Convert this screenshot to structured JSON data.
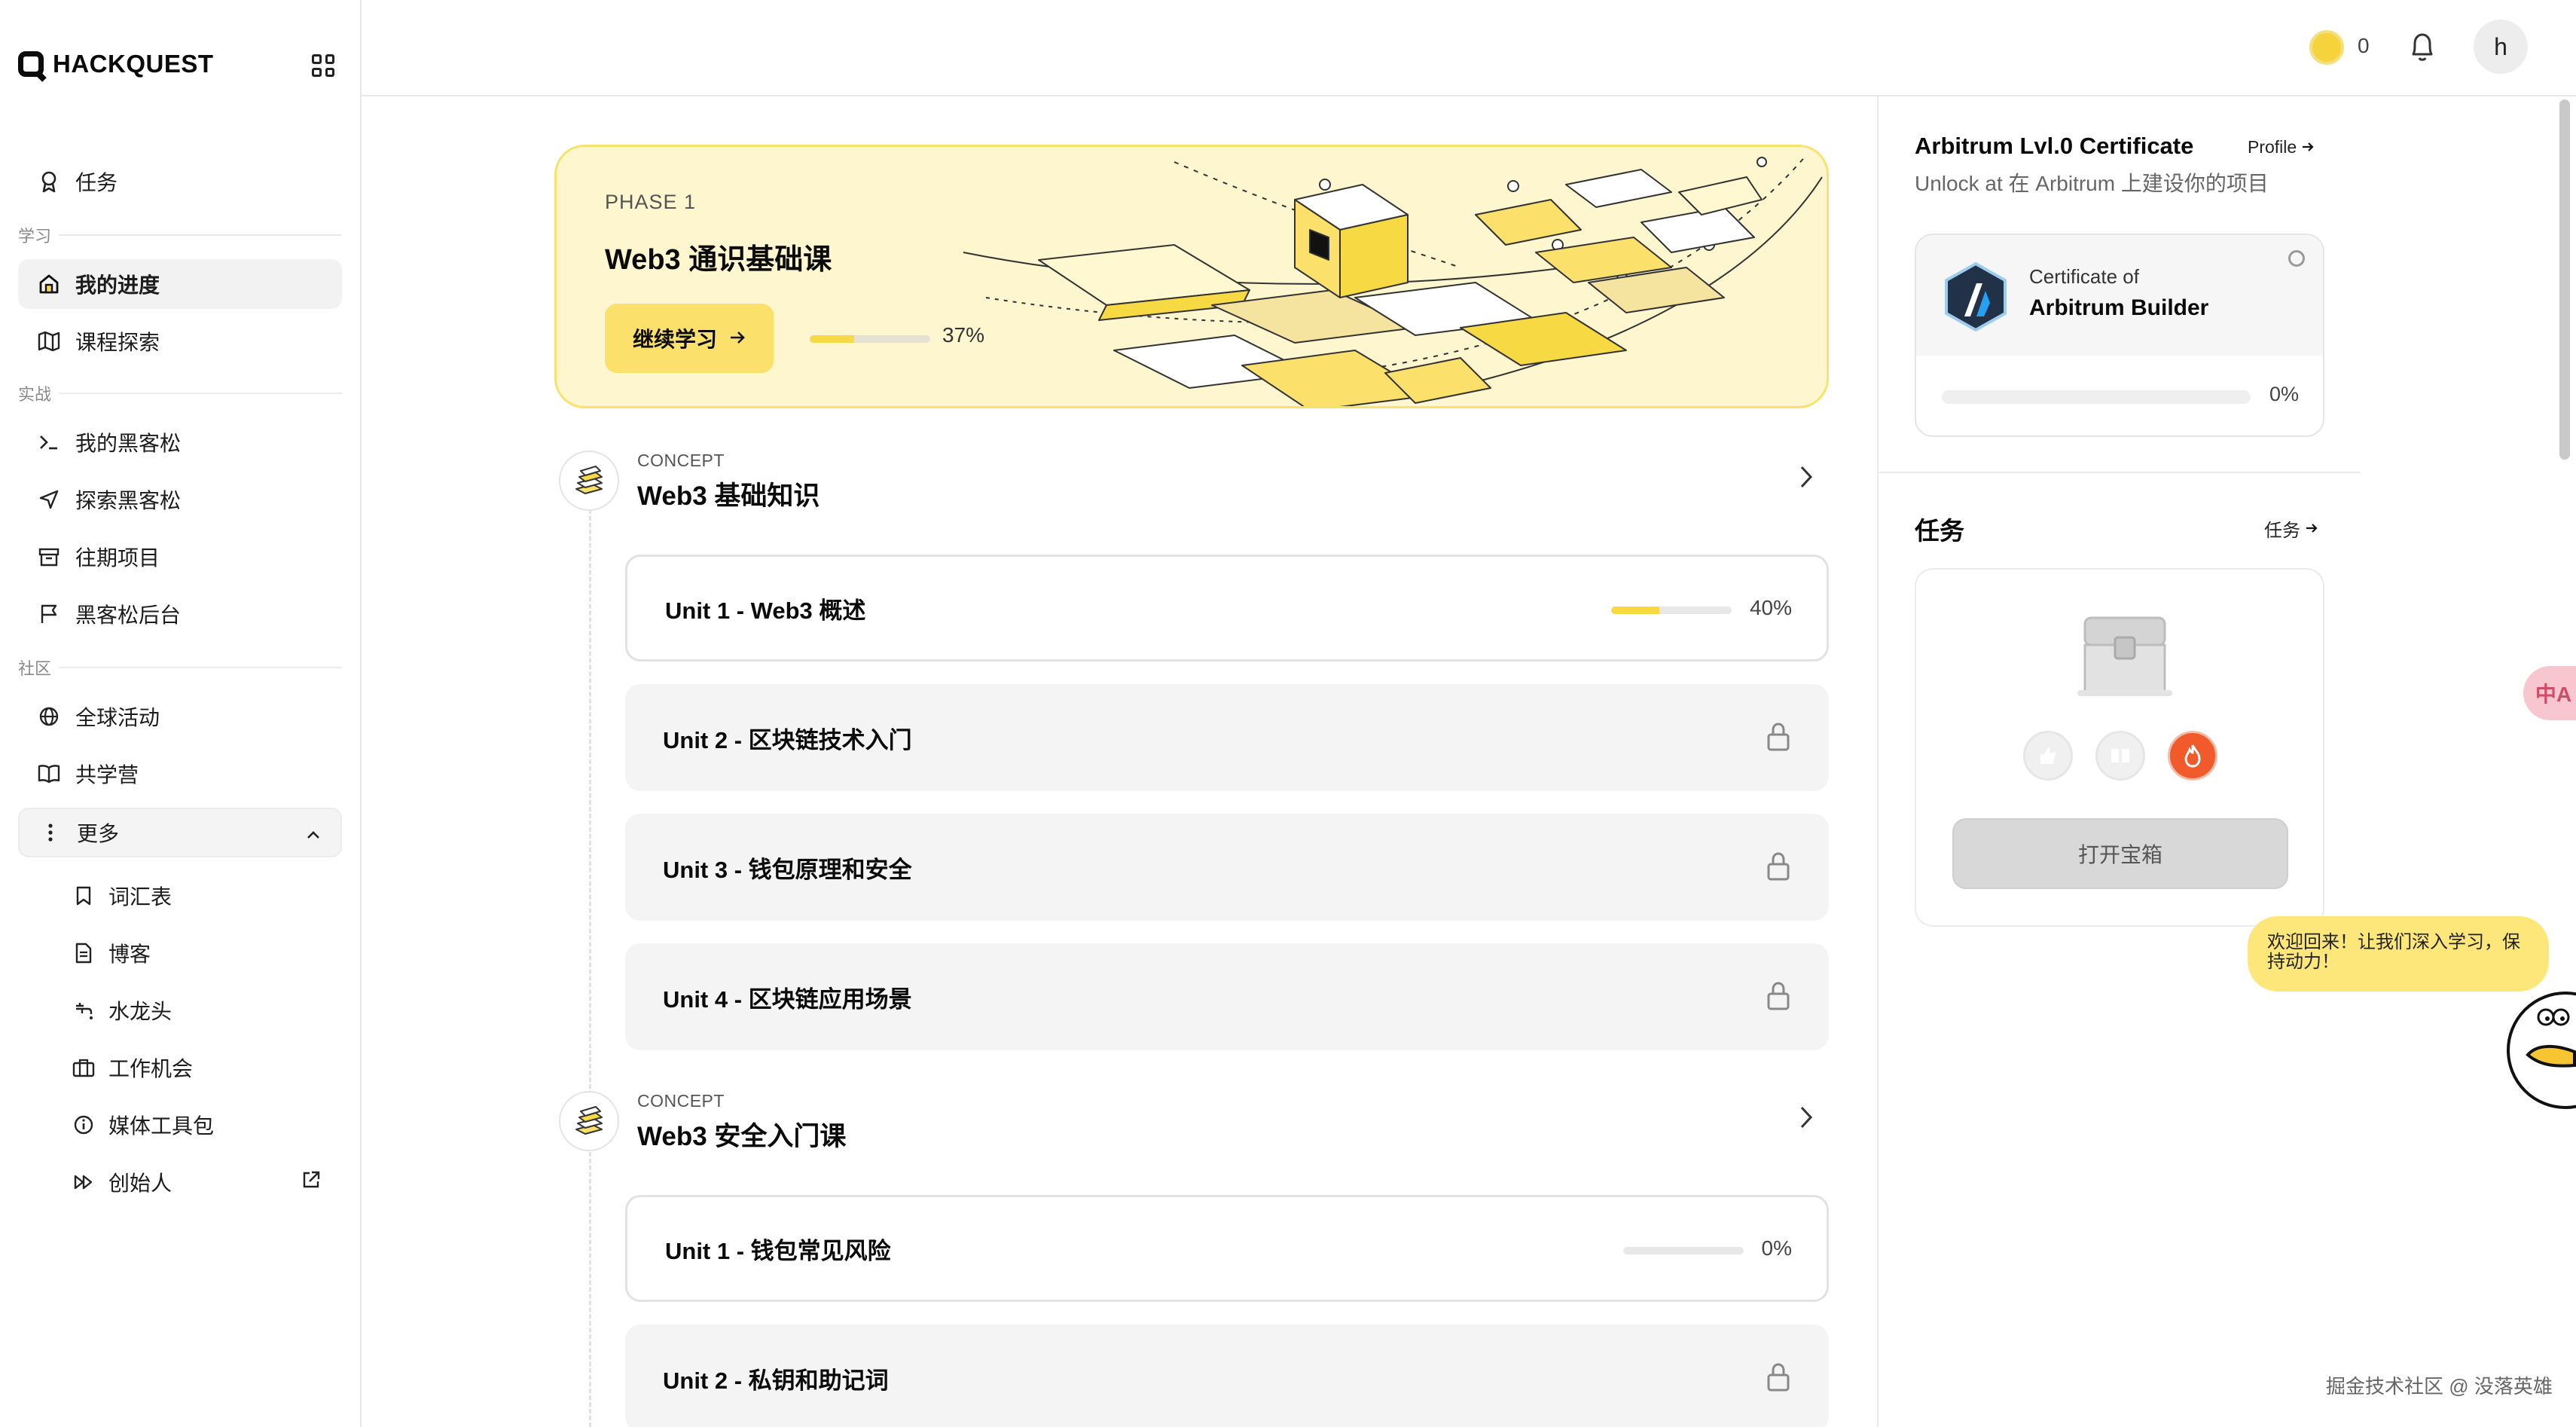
{
  "brand": {
    "name": "HACKQUEST"
  },
  "sidebar": {
    "top_item": {
      "label": "任务",
      "icon": "medal-icon"
    },
    "sections": {
      "learn": "学习",
      "practice": "实战",
      "community": "社区"
    },
    "learn_items": [
      {
        "label": "我的进度",
        "icon": "home-icon",
        "active": true
      },
      {
        "label": "课程探索",
        "icon": "map-icon"
      }
    ],
    "practice_items": [
      {
        "label": "我的黑客松",
        "icon": "terminal-icon"
      },
      {
        "label": "探索黑客松",
        "icon": "send-icon"
      },
      {
        "label": "往期项目",
        "icon": "archive-icon"
      },
      {
        "label": "黑客松后台",
        "icon": "flag-icon"
      }
    ],
    "community_items": [
      {
        "label": "全球活动",
        "icon": "globe-icon"
      },
      {
        "label": "共学营",
        "icon": "book-icon"
      }
    ],
    "more": {
      "label": "更多",
      "expanded": true
    },
    "more_items": [
      {
        "label": "词汇表",
        "icon": "bookmark-icon"
      },
      {
        "label": "博客",
        "icon": "document-icon"
      },
      {
        "label": "水龙头",
        "icon": "faucet-icon"
      },
      {
        "label": "工作机会",
        "icon": "briefcase-icon"
      },
      {
        "label": "媒体工具包",
        "icon": "info-icon"
      },
      {
        "label": "创始人",
        "icon": "fast-forward-icon",
        "external": true
      }
    ]
  },
  "topbar": {
    "coins": "0",
    "avatar_initial": "h"
  },
  "phase": {
    "label": "PHASE 1",
    "title": "Web3 通识基础课",
    "button": "继续学习",
    "progress": 0.37,
    "progress_text": "37%"
  },
  "concepts": [
    {
      "tag": "CONCEPT",
      "title": "Web3 基础知识",
      "units": [
        {
          "label": "Unit 1 - Web3 概述",
          "state": "open",
          "progress": 0.4,
          "progress_text": "40%"
        },
        {
          "label": "Unit 2 - 区块链技术入门",
          "state": "locked"
        },
        {
          "label": "Unit 3 - 钱包原理和安全",
          "state": "locked"
        },
        {
          "label": "Unit 4 - 区块链应用场景",
          "state": "locked"
        }
      ]
    },
    {
      "tag": "CONCEPT",
      "title": "Web3 安全入门课",
      "units": [
        {
          "label": "Unit 1 - 钱包常见风险",
          "state": "open",
          "progress": 0,
          "progress_text": "0%"
        },
        {
          "label": "Unit 2 - 私钥和助记词",
          "state": "locked"
        }
      ]
    }
  ],
  "certificate": {
    "title": "Arbitrum Lvl.0 Certificate",
    "profile_link": "Profile",
    "subtitle": "Unlock at 在 Arbitrum 上建设你的项目",
    "card_prefix": "Certificate of",
    "card_name": "Arbitrum Builder",
    "progress": 0,
    "progress_text": "0%"
  },
  "tasks": {
    "title": "任务",
    "link": "任务",
    "button": "打开宝箱"
  },
  "chat": {
    "message": "欢迎回来！让我们深入学习，保持动力！"
  },
  "translate_label": "中A",
  "watermark": "掘金技术社区 @ 没落英雄",
  "colors": {
    "accent": "#fbe16b",
    "accent_bg": "#fdf6cf",
    "fire": "#f15a2b"
  }
}
